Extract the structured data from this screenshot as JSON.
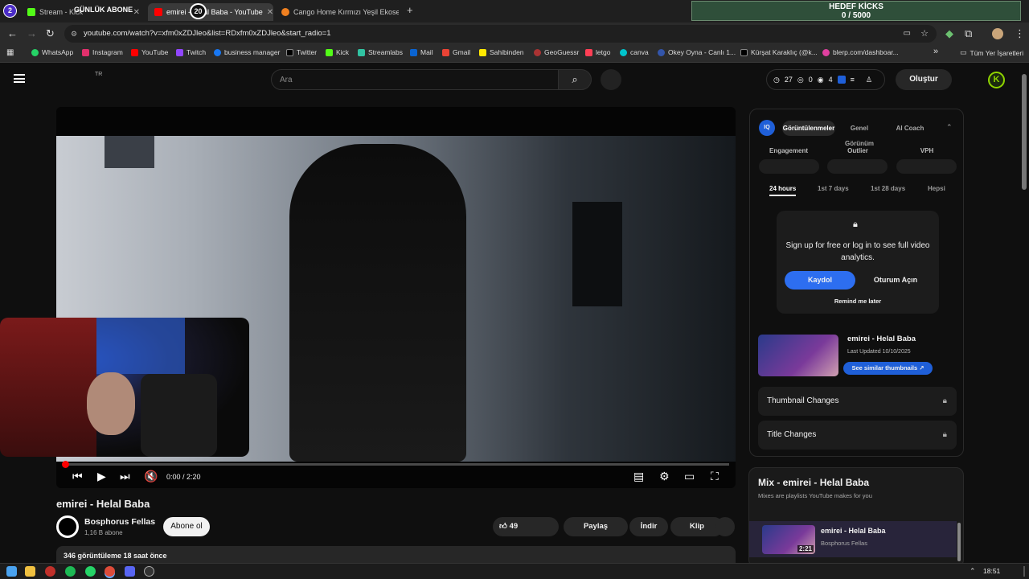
{
  "browser": {
    "tabs": [
      {
        "label": "Stream - Kick",
        "color": "#53fc18"
      },
      {
        "label": "emirei - Helal Baba - YouTube",
        "color": "#ff0000"
      },
      {
        "label": "Cango Home Kırmızı Yeşil Ekose",
        "color": "#f08020"
      }
    ],
    "overlay_badge_left": "2",
    "overlay_label": "GÜNLÜK ABONE",
    "overlay_badge_count": "20",
    "new_tab": "+",
    "goal": {
      "title": "HEDEF KİCKS",
      "progress": "0 / 5000"
    },
    "url": "youtube.com/watch?v=xfm0xZDJleo&list=RDxfm0xZDJleo&start_radio=1",
    "bookmarks": [
      {
        "label": "WhatsApp",
        "color": "#25d366"
      },
      {
        "label": "Instagram",
        "color": "#e1306c"
      },
      {
        "label": "YouTube",
        "color": "#ff0000"
      },
      {
        "label": "Twitch",
        "color": "#9146ff"
      },
      {
        "label": "business manager",
        "color": "#1877f2"
      },
      {
        "label": "Twitter",
        "color": "#000000"
      },
      {
        "label": "Kick",
        "color": "#53fc18"
      },
      {
        "label": "Streamlabs",
        "color": "#31c3a2"
      },
      {
        "label": "Mail",
        "color": "#0a64d2"
      },
      {
        "label": "Gmail",
        "color": "#ea4335"
      },
      {
        "label": "Sahibinden",
        "color": "#ffe800"
      },
      {
        "label": "GeoGuessr",
        "color": "#a33"
      },
      {
        "label": "letgo",
        "color": "#ff3f55"
      },
      {
        "label": "canva",
        "color": "#00c4cc"
      },
      {
        "label": "Okey Oyna - Canlı 1...",
        "color": "#3355aa"
      },
      {
        "label": "Kürşat Karaklıç (@k...",
        "color": "#000000"
      },
      {
        "label": "blerp.com/dashboar...",
        "color": "#e040a0"
      }
    ],
    "bookmarks_more": "»",
    "all_bookmarks": "Tüm Yer İşaretleri"
  },
  "youtube": {
    "region": "TR",
    "search_placeholder": "Ara",
    "stats": {
      "a": "27",
      "b": "0",
      "c": "4"
    },
    "create_label": "Oluştur",
    "avatar_letter": "K",
    "player": {
      "time": "0:00 / 2:20"
    },
    "video_title": "emirei - Helal Baba",
    "channel": {
      "name": "Bosphorus Fellas",
      "subs": "1,16 B abone"
    },
    "subscribe_label": "Abone ol",
    "likes": "49",
    "share_label": "Paylaş",
    "download_label": "İndir",
    "clip_label": "Klip",
    "description": "346 görüntüleme  18 saat önce"
  },
  "panel": {
    "logo": "IQ",
    "tabs": [
      "Görüntülenmeler",
      "Genel Görünüm",
      "AI Coach"
    ],
    "metrics": [
      "Engagement",
      "Outlier",
      "VPH"
    ],
    "ranges": [
      "24 hours",
      "1st 7 days",
      "1st 28 days",
      "Hepsi"
    ],
    "signup_text": "Sign up for free or log in to see full video analytics.",
    "signup_button": "Kaydol",
    "login_button": "Oturum Açın",
    "remind": "Remind me later",
    "thumb_title": "emirei - Helal Baba",
    "thumb_updated": "Last Updated 10/10/2025",
    "thumb_button": "See similar thumbnails ↗",
    "row1": "Thumbnail Changes",
    "row2": "Title Changes"
  },
  "mix": {
    "title": "Mix - emirei - Helal Baba",
    "subtitle": "Mixes are playlists YouTube makes for you",
    "item_title": "emirei - Helal Baba",
    "item_channel": "Bosphorus Fellas",
    "item_duration": "2:21"
  },
  "taskbar": {
    "time": "18:51",
    "chevron": "⌃"
  }
}
